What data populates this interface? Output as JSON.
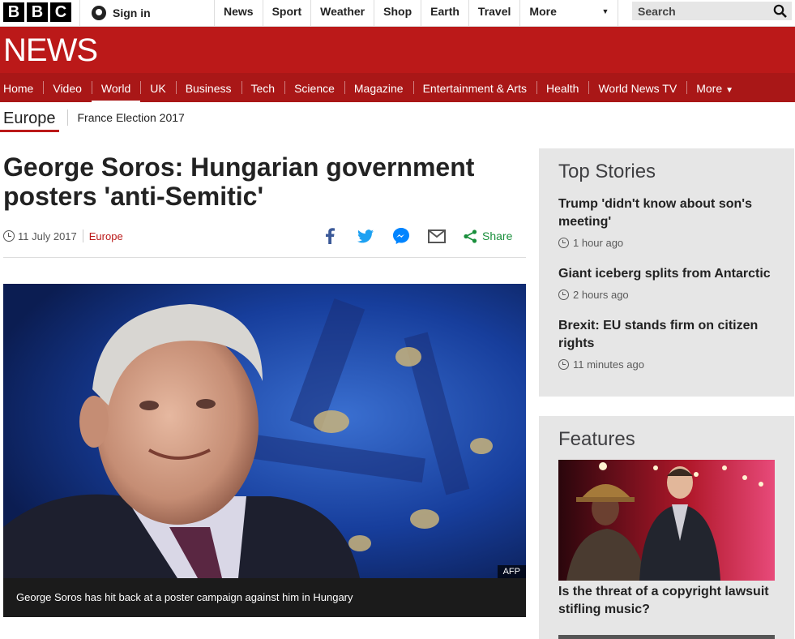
{
  "topbar": {
    "logo": [
      "B",
      "B",
      "C"
    ],
    "signin_label": "Sign in",
    "nav": [
      "News",
      "Sport",
      "Weather",
      "Shop",
      "Earth",
      "Travel"
    ],
    "more_label": "More",
    "search_placeholder": "Search"
  },
  "brand": "NEWS",
  "section_nav": [
    {
      "label": "Home"
    },
    {
      "label": "Video"
    },
    {
      "label": "World",
      "active": true
    },
    {
      "label": "UK"
    },
    {
      "label": "Business"
    },
    {
      "label": "Tech"
    },
    {
      "label": "Science"
    },
    {
      "label": "Magazine"
    },
    {
      "label": "Entertainment & Arts"
    },
    {
      "label": "Health"
    },
    {
      "label": "World News TV"
    },
    {
      "label": "More",
      "dropdown": true
    }
  ],
  "subnav": {
    "current": "Europe",
    "link": "France Election 2017"
  },
  "article": {
    "headline": "George Soros: Hungarian government posters 'anti-Semitic'",
    "date": "11 July 2017",
    "section": "Europe",
    "share_label": "Share",
    "share_icons": [
      "facebook-icon",
      "twitter-icon",
      "messenger-icon",
      "email-icon",
      "share-icon"
    ],
    "image_credit": "AFP",
    "image_caption": "George Soros has hit back at a poster campaign against him in Hungary"
  },
  "top_stories": {
    "title": "Top Stories",
    "items": [
      {
        "title": "Trump 'didn't know about son's meeting'",
        "ago": "1 hour ago"
      },
      {
        "title": "Giant iceberg splits from Antarctic",
        "ago": "2 hours ago"
      },
      {
        "title": "Brexit: EU stands firm on citizen rights",
        "ago": "11 minutes ago"
      }
    ]
  },
  "features": {
    "title": "Features",
    "item_title": "Is the threat of a copyright lawsuit stifling music?"
  },
  "colors": {
    "brand_red": "#bb1919",
    "nav_red": "#a91717",
    "share_green": "#1a8f3c",
    "panel_grey": "#e6e6e6"
  }
}
